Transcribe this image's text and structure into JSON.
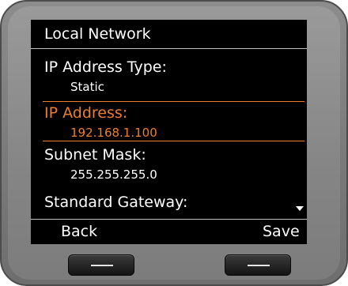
{
  "screen": {
    "title": "Local Network",
    "fields": [
      {
        "label": "IP Address Type:",
        "value": "Static"
      },
      {
        "label": "IP Address:",
        "value": "192.168.1.100"
      },
      {
        "label": "Subnet Mask:",
        "value": "255.255.255.0"
      },
      {
        "label": "Standard Gateway:",
        "value": ""
      }
    ],
    "selected_field": "IP Address:"
  },
  "softkeys": {
    "left_label": "Back",
    "right_label": "Save"
  },
  "icons": {
    "scroll": "scroll-down-arrow",
    "softkey_marks": "dash"
  },
  "colors": {
    "screen_background": "#000000",
    "text": "#ffffff",
    "selection_accent": "#ee7d30",
    "bezel": "#858585"
  }
}
